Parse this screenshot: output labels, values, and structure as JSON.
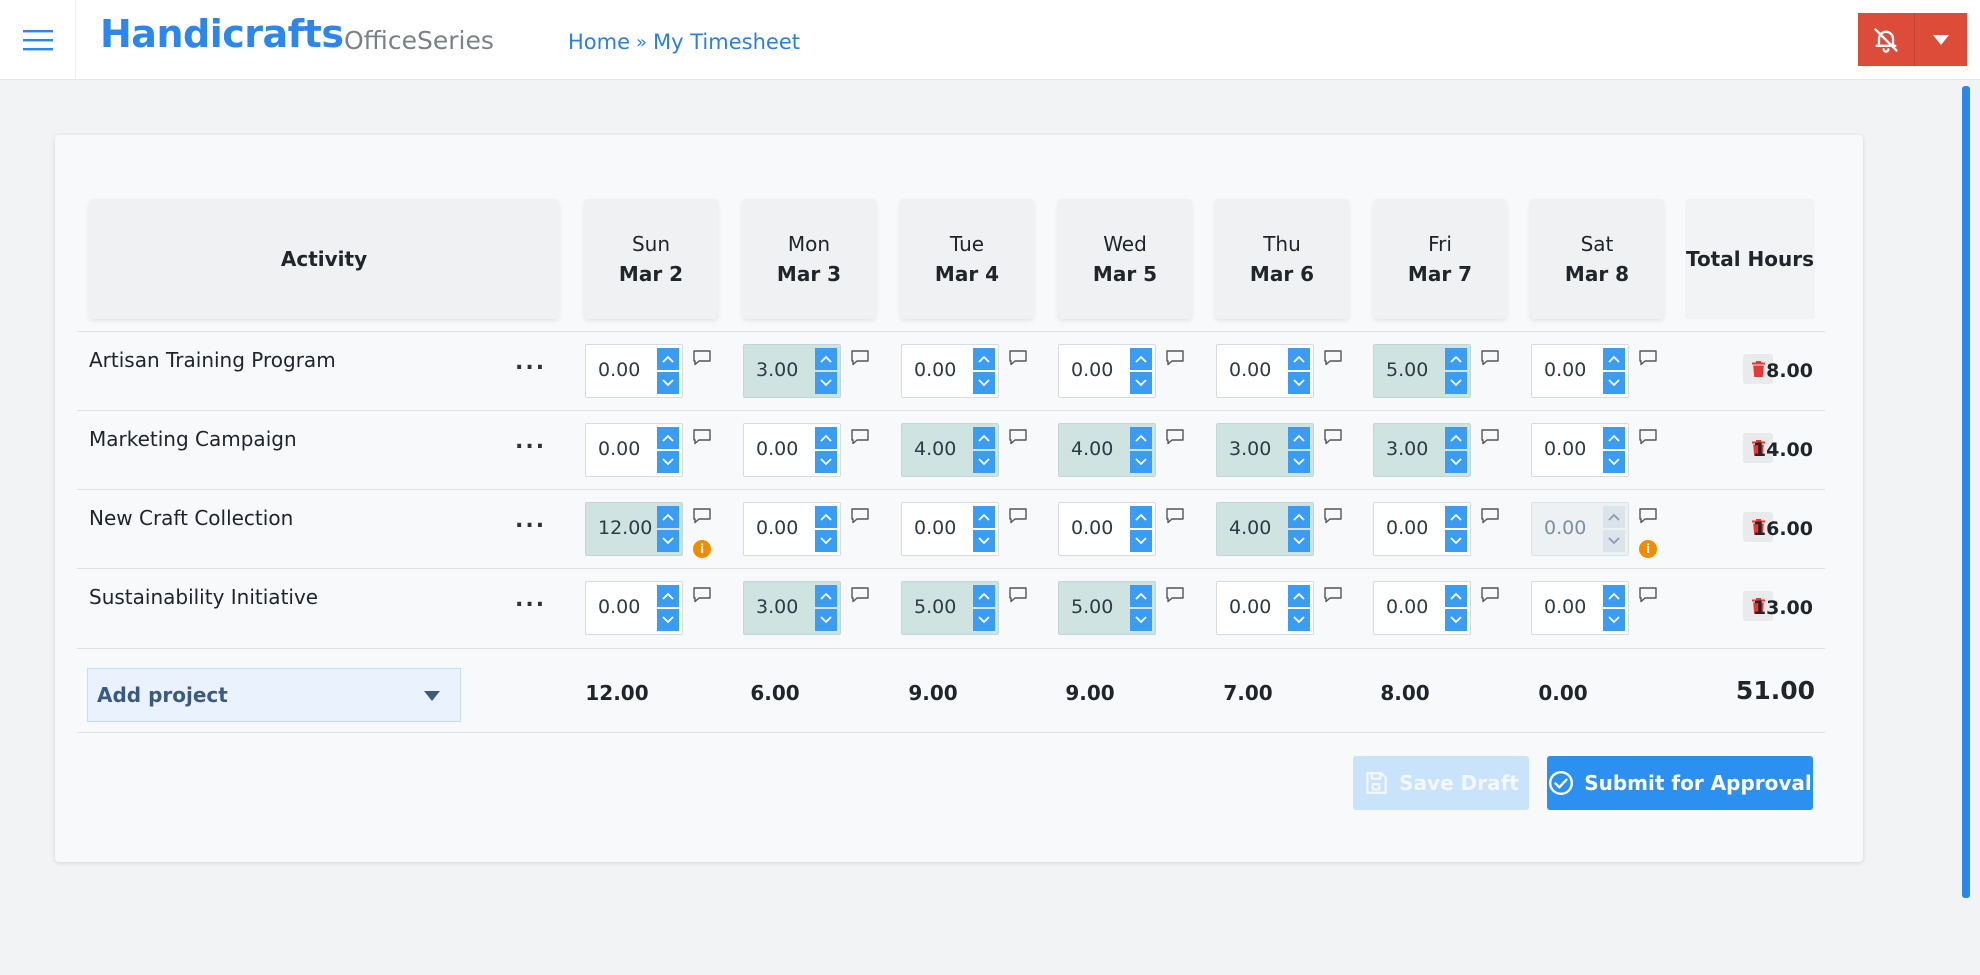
{
  "header": {
    "brand": "Handicrafts",
    "suite": "OfficeSeries",
    "breadcrumb": [
      "Home",
      "My Timesheet"
    ],
    "breadcrumb_sep": "»"
  },
  "table": {
    "activity_header": "Activity",
    "total_header": "Total Hours",
    "days": [
      {
        "day": "Sun",
        "date": "Mar 2"
      },
      {
        "day": "Mon",
        "date": "Mar 3"
      },
      {
        "day": "Tue",
        "date": "Mar 4"
      },
      {
        "day": "Wed",
        "date": "Mar 5"
      },
      {
        "day": "Thu",
        "date": "Mar 6"
      },
      {
        "day": "Fri",
        "date": "Mar 7"
      },
      {
        "day": "Sat",
        "date": "Mar 8"
      }
    ],
    "rows": [
      {
        "name": "Artisan Training Program",
        "hours": [
          "0.00",
          "3.00",
          "0.00",
          "0.00",
          "0.00",
          "5.00",
          "0.00"
        ],
        "total": "8.00"
      },
      {
        "name": "Marketing Campaign",
        "hours": [
          "0.00",
          "0.00",
          "4.00",
          "4.00",
          "3.00",
          "3.00",
          "0.00"
        ],
        "total": "14.00"
      },
      {
        "name": "New Craft Collection",
        "hours": [
          "12.00",
          "0.00",
          "0.00",
          "0.00",
          "4.00",
          "0.00",
          "0.00"
        ],
        "total": "16.00"
      },
      {
        "name": "Sustainability Initiative",
        "hours": [
          "0.00",
          "3.00",
          "5.00",
          "5.00",
          "0.00",
          "0.00",
          "0.00"
        ],
        "total": "13.00"
      }
    ],
    "more_label": "...",
    "warn_label": "i",
    "add_project_label": "Add project",
    "day_totals": [
      "12.00",
      "6.00",
      "9.00",
      "9.00",
      "7.00",
      "8.00",
      "0.00"
    ],
    "grand_total": "51.00"
  },
  "actions": {
    "save_draft": "Save Draft",
    "submit": "Submit for Approval"
  },
  "colors": {
    "brand": "#2b87ee",
    "alert": "#dd4b39",
    "filled_cell": "#cfe3e1",
    "primary_button": "#2b90f0"
  }
}
